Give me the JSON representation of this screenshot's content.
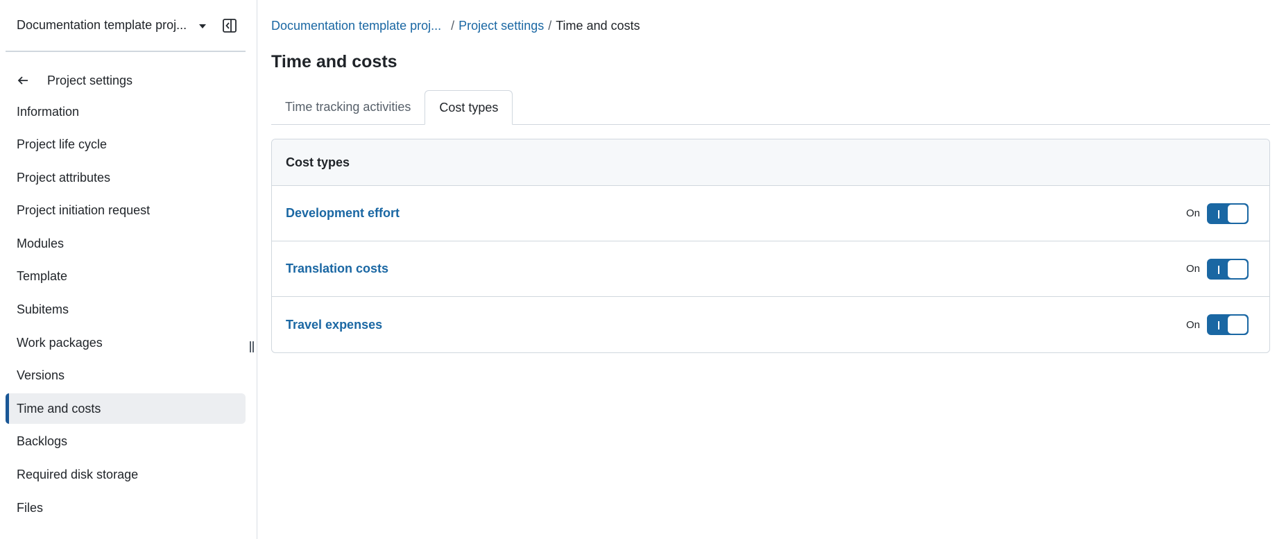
{
  "sidebar": {
    "project_name": "Documentation template proj...",
    "back_label": "Project settings",
    "items": [
      {
        "label": "Information",
        "active": false
      },
      {
        "label": "Project life cycle",
        "active": false
      },
      {
        "label": "Project attributes",
        "active": false
      },
      {
        "label": "Project initiation request",
        "active": false
      },
      {
        "label": "Modules",
        "active": false
      },
      {
        "label": "Template",
        "active": false
      },
      {
        "label": "Subitems",
        "active": false
      },
      {
        "label": "Work packages",
        "active": false
      },
      {
        "label": "Versions",
        "active": false
      },
      {
        "label": "Time and costs",
        "active": true
      },
      {
        "label": "Backlogs",
        "active": false
      },
      {
        "label": "Required disk storage",
        "active": false
      },
      {
        "label": "Files",
        "active": false
      }
    ]
  },
  "breadcrumb": {
    "items": [
      "Documentation template proj...",
      "Project settings"
    ],
    "separator": "/",
    "current": "Time and costs"
  },
  "page": {
    "title": "Time and costs"
  },
  "tabs": [
    {
      "label": "Time tracking activities",
      "selected": false
    },
    {
      "label": "Cost types",
      "selected": true
    }
  ],
  "panel": {
    "header": "Cost types",
    "rows": [
      {
        "name": "Development effort",
        "status": "On"
      },
      {
        "name": "Translation costs",
        "status": "On"
      },
      {
        "name": "Travel expenses",
        "status": "On"
      }
    ]
  },
  "colors": {
    "accent": "#1a67a3",
    "active_bar": "#1a5796",
    "active_bg": "#eceef1",
    "header_bg": "#f6f8fa",
    "border": "#d0d7de"
  }
}
